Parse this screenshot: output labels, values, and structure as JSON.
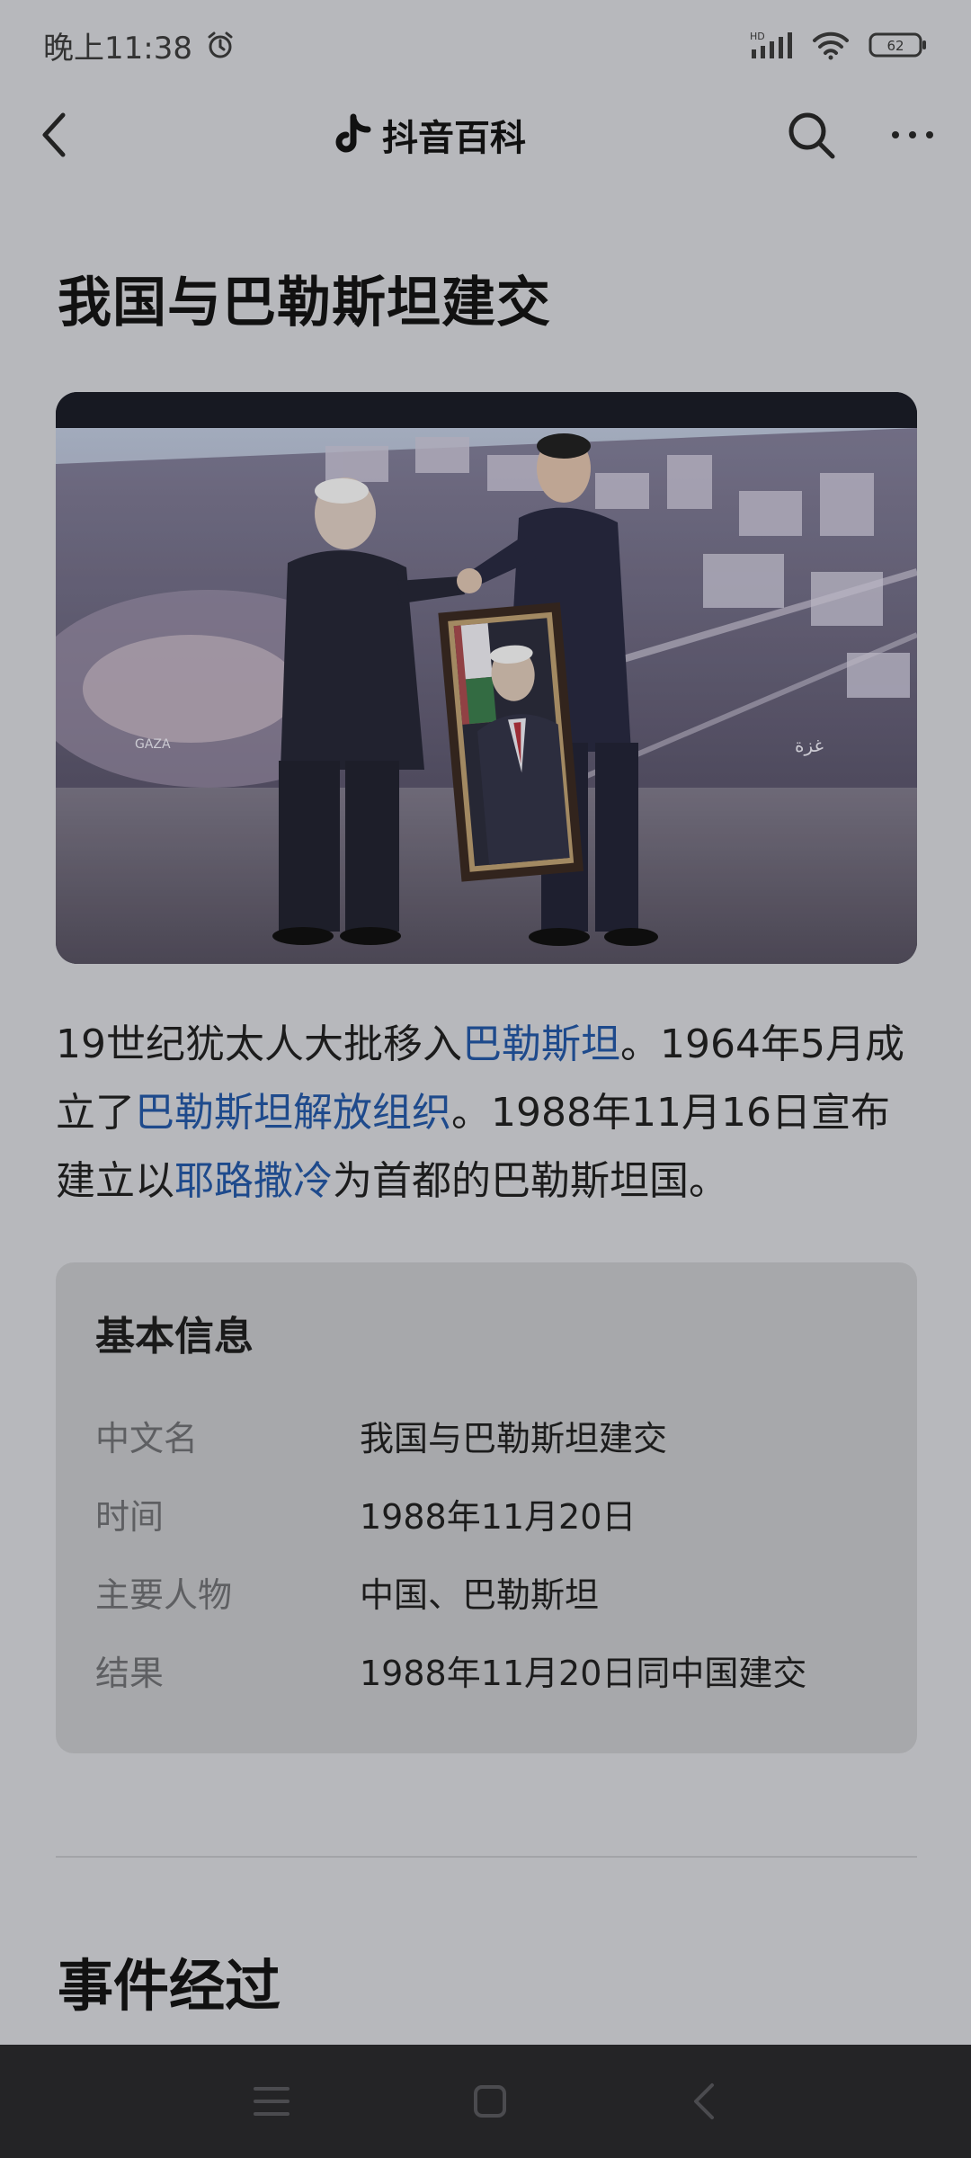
{
  "status": {
    "time": "晚上11:38",
    "network": "HD",
    "battery": "62"
  },
  "header": {
    "app_title": "抖音百科"
  },
  "article": {
    "title": "我国与巴勒斯坦建交",
    "image_alt": "handshake portrait presentation photo",
    "image_caption_left": "GAZA",
    "image_caption_right": "غزة",
    "summary": {
      "part1": "19世纪犹太人大批移入",
      "link1": "巴勒斯坦",
      "part2": "。1964年5月成立了",
      "link2": "巴勒斯坦解放组织",
      "part3": "。1988年11月16日宣布建立以",
      "link3": "耶路撒冷",
      "part4": "为首都的巴勒斯坦国。"
    }
  },
  "infobox": {
    "title": "基本信息",
    "rows": [
      {
        "label": "中文名",
        "value": "我国与巴勒斯坦建交"
      },
      {
        "label": "时间",
        "value": "1988年11月20日"
      },
      {
        "label": "主要人物",
        "value": "中国、巴勒斯坦"
      },
      {
        "label": "结果",
        "value": "1988年11月20日同中国建交"
      }
    ]
  },
  "sections": {
    "next_title": "事件经过"
  },
  "icons": {
    "alarm": "alarm-icon",
    "signal": "signal-icon",
    "wifi": "wifi-icon",
    "battery": "battery-icon",
    "back": "back-arrow-icon",
    "logo": "douyin-logo-icon",
    "search": "search-icon",
    "more": "more-icon",
    "menu": "menu-icon",
    "home": "home-icon",
    "nav_back": "nav-back-icon"
  }
}
